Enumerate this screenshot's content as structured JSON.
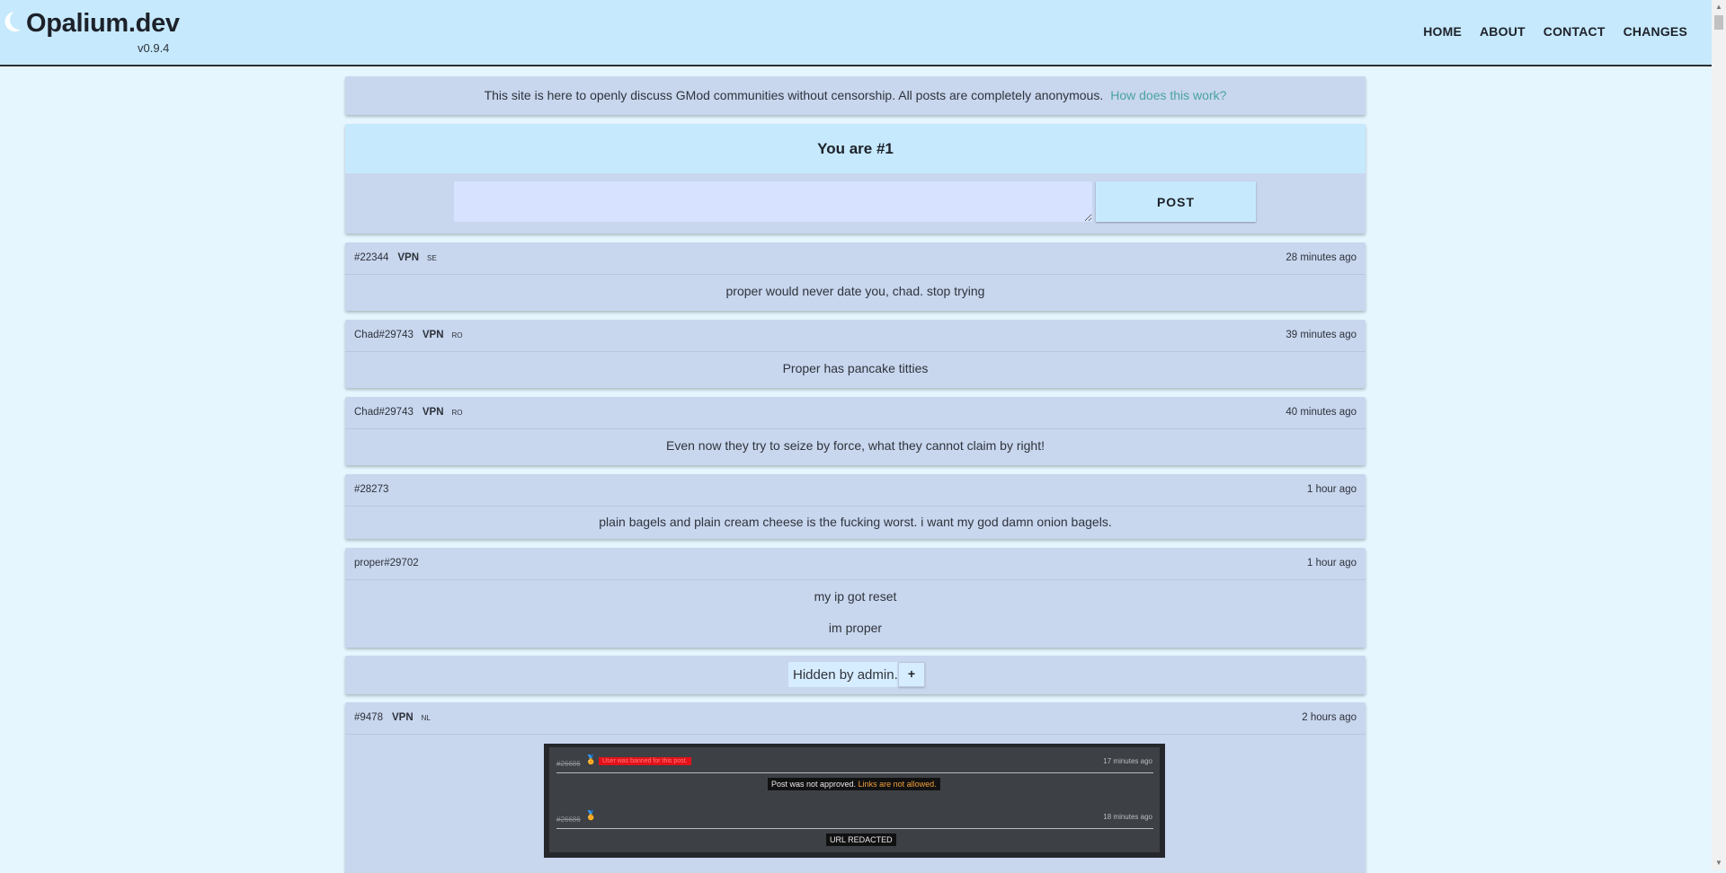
{
  "brand": {
    "name": "Opalium.dev",
    "version": "v0.9.4"
  },
  "nav": [
    "HOME",
    "ABOUT",
    "CONTACT",
    "CHANGES"
  ],
  "notice": {
    "text": "This site is here to openly discuss GMod communities without censorship. All posts are completely anonymous.",
    "link": "How does this work?"
  },
  "composer": {
    "title": "You are #1",
    "post_label": "POST",
    "placeholder": ""
  },
  "posts": [
    {
      "author": "#22344",
      "vpn": "VPN",
      "country": "SE",
      "time": "28 minutes ago",
      "lines": [
        "proper would never date you, chad. stop trying"
      ]
    },
    {
      "author": "Chad#29743",
      "vpn": "VPN",
      "country": "RO",
      "time": "39 minutes ago",
      "lines": [
        "Proper has pancake titties"
      ]
    },
    {
      "author": "Chad#29743",
      "vpn": "VPN",
      "country": "RO",
      "time": "40 minutes ago",
      "lines": [
        "Even now they try to seize by force, what they cannot claim by right!"
      ]
    },
    {
      "author": "#28273",
      "vpn": "",
      "country": "",
      "time": "1 hour ago",
      "lines": [
        "plain bagels and plain cream cheese is the fucking worst. i want my god damn onion bagels."
      ]
    },
    {
      "author": "proper#29702",
      "vpn": "",
      "country": "",
      "time": "1 hour ago",
      "lines": [
        "my ip got reset",
        "im proper"
      ]
    }
  ],
  "hidden": {
    "label": "Hidden by admin.",
    "expand": "+"
  },
  "image_post": {
    "author": "#9478",
    "vpn": "VPN",
    "country": "NL",
    "time": "2 hours ago",
    "screenshot": {
      "row1": {
        "user": "#26686",
        "ban": "User was banned for this post.",
        "time": "17 minutes ago",
        "message": "Post was not approved.",
        "reason": "Links are not allowed."
      },
      "row2": {
        "user": "#26686",
        "time": "18 minutes ago",
        "message": "URL REDACTED"
      }
    }
  },
  "icons": {
    "logo": "moon-icon",
    "medal": "medal-icon",
    "scroll_up": "triangle-up-icon",
    "scroll_down": "triangle-down-icon"
  }
}
